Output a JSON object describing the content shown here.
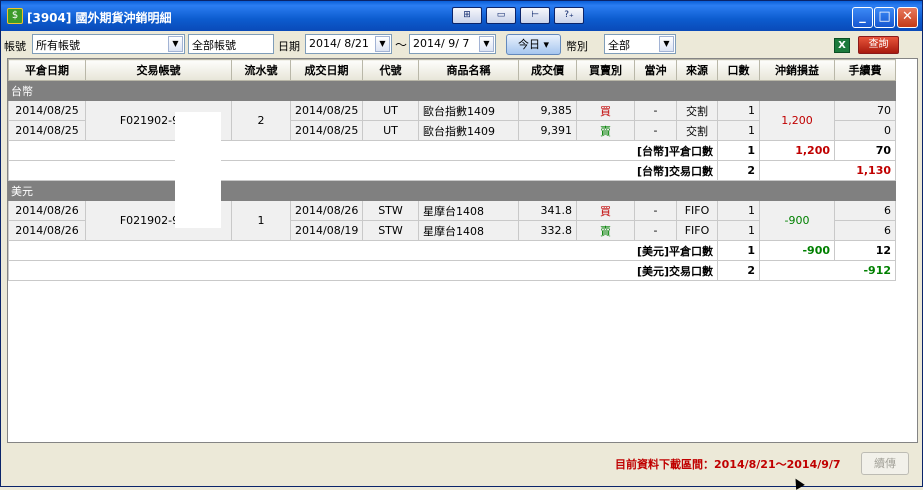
{
  "window": {
    "title": "[3904] 國外期貨沖銷明細",
    "tools": [
      "⊞",
      "▭",
      "⊢",
      "?₊"
    ],
    "controls": {
      "minimize": "_",
      "maximize": "□",
      "close": "✕"
    }
  },
  "toolbar": {
    "account_label": "帳號",
    "account_value": "所有帳號",
    "account_name": "全部帳號",
    "date_label": "日期",
    "date_from": "2014/ 8/21",
    "date_sep": "～",
    "date_to": "2014/ 9/ 7",
    "today_label": "今日 ▾",
    "currency_label": "幣別",
    "currency_value": "全部",
    "query_label": "查詢"
  },
  "table": {
    "columns": [
      "平倉日期",
      "交易帳號",
      "流水號",
      "成交日期",
      "代號",
      "商品名稱",
      "成交價",
      "買賣別",
      "當沖",
      "來源",
      "口數",
      "沖銷損益",
      "手續費"
    ],
    "groups": [
      {
        "name": "台幣",
        "close_date_1": "2014/08/25",
        "close_date_2": "2014/08/25",
        "account": "F021902-902-",
        "serial": "2",
        "trades": [
          {
            "trade_date": "2014/08/25",
            "code": "UT",
            "product": "歐台指數1409",
            "price": "9,385",
            "side": "買",
            "daytrade": "-",
            "source": "交割",
            "qty": "1",
            "fee": "70"
          },
          {
            "trade_date": "2014/08/25",
            "code": "UT",
            "product": "歐台指數1409",
            "price": "9,391",
            "side": "賣",
            "daytrade": "-",
            "source": "交割",
            "qty": "1",
            "fee": "0"
          }
        ],
        "pnl": "1,200",
        "close_summary": {
          "label": "[台幣]平倉口數",
          "qty": "1",
          "pnl": "1,200",
          "fee": "70"
        },
        "trade_summary": {
          "label": "[台幣]交易口數",
          "qty": "2",
          "total": "1,130"
        }
      },
      {
        "name": "美元",
        "close_date_1": "2014/08/26",
        "close_date_2": "2014/08/26",
        "account": "F021902-902-",
        "serial": "1",
        "trades": [
          {
            "trade_date": "2014/08/26",
            "code": "STW",
            "product": "星摩台1408",
            "price": "341.8",
            "side": "買",
            "daytrade": "-",
            "source": "FIFO",
            "qty": "1",
            "fee": "6"
          },
          {
            "trade_date": "2014/08/19",
            "code": "STW",
            "product": "星摩台1408",
            "price": "332.8",
            "side": "賣",
            "daytrade": "-",
            "source": "FIFO",
            "qty": "1",
            "fee": "6"
          }
        ],
        "pnl": "-900",
        "close_summary": {
          "label": "[美元]平倉口數",
          "qty": "1",
          "pnl": "-900",
          "fee": "12"
        },
        "trade_summary": {
          "label": "[美元]交易口數",
          "qty": "2",
          "total": "-912"
        }
      }
    ]
  },
  "footer": {
    "download_range": "目前資料下載區間：2014/8/21～2014/9/7",
    "continue_label": "續傳"
  },
  "colors": {
    "buy": "#c00000",
    "sell": "#008000",
    "profit": "#c00000",
    "loss": "#008000"
  }
}
